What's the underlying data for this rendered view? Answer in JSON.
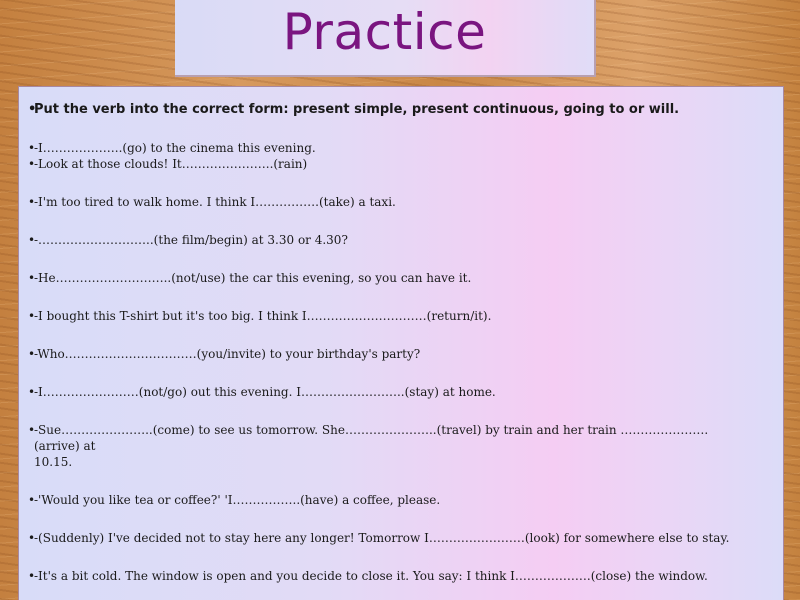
{
  "slide": {
    "title": "Practice",
    "instruction": "Put the verb into the correct form: present simple, present continuous, going to or will.",
    "exercises": [
      "-I………………..(go) to the cinema this evening.",
      "-Look at those clouds! It…………………..(rain)",
      "-I'm too tired to walk home. I think I…………….(take) a taxi.",
      "-………………………..(the film/begin) at 3.30 or 4.30?",
      "-He………………………..(not/use) the car this evening, so you can have it.",
      "-I bought this T-shirt but it's too big. I think I…………………………(return/it).",
      "-Who……………………………(you/invite) to your birthday's party?",
      "-I……………………(not/go) out this evening. I……………………..(stay) at home.",
      "-Sue…………………..(come) to see us tomorrow. She…………………..(travel) by train and her train ………………….(arrive) at",
      "10.15.",
      "-'Would you like tea or coffee?' 'I……………..(have) a coffee, please.",
      "-(Suddenly) I've decided not to stay here any longer! Tomorrow I……………………(look) for somewhere else to stay.",
      "-It's a bit cold. The window is open and you decide to close it. You say: I think I……………….(close) the window."
    ]
  }
}
